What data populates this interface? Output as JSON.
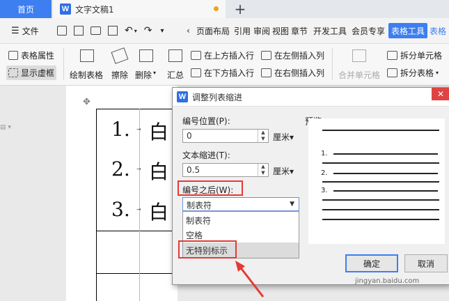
{
  "tabs": {
    "home": "首页",
    "doc_logo": "W",
    "doc_title": "文字文稿1",
    "add": "+"
  },
  "menu": {
    "file": "文件",
    "items": [
      "页面布局",
      "引用",
      "审阅",
      "视图",
      "章节",
      "开发工具",
      "会员专享"
    ],
    "active": "表格工具",
    "cut": "表格"
  },
  "ribbon": {
    "table_props": "表格属性",
    "show_gridlines": "显示虚框",
    "draw_table": "绘制表格",
    "erase": "擦除",
    "delete": "删除",
    "summary": "汇总",
    "insert_above": "在上方插入行",
    "insert_below": "在下方插入行",
    "insert_left": "在左侧插入列",
    "insert_right": "在右侧插入列",
    "merge_cells": "合并单元格",
    "split_cells": "拆分单元格",
    "split_table": "拆分表格"
  },
  "document": {
    "numbers": [
      "1.",
      "2.",
      "3."
    ],
    "cell_char": "白",
    "arrow": "→"
  },
  "dialog": {
    "logo": "W",
    "title": "调整列表缩进",
    "close": "✕",
    "number_position_label": "编号位置(P):",
    "number_position_value": "0",
    "unit": "厘米▾",
    "text_indent_label": "文本缩进(T):",
    "text_indent_value": "0.5",
    "after_number_label": "编号之后(W):",
    "after_number_value": "制表符",
    "options": [
      "制表符",
      "空格",
      "无特别标示"
    ],
    "preview_label": "预览",
    "preview_numbers": [
      "1.",
      "2.",
      "3."
    ],
    "ok": "确定",
    "cancel": "取消"
  },
  "watermark": "jingyan.baidu.com",
  "colors": {
    "accent": "#3d7ef0",
    "highlight": "#e53935"
  }
}
